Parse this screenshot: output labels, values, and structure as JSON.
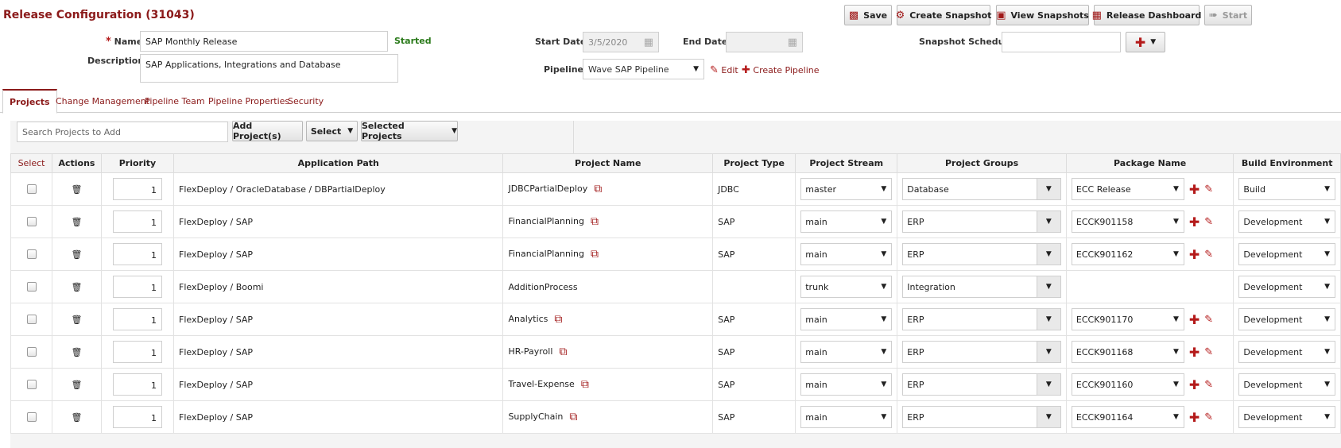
{
  "header": {
    "title": "Release Configuration (31043)",
    "buttons": {
      "save": "Save",
      "create_snapshot": "Create Snapshot",
      "view_snapshots": "View Snapshots",
      "release_dashboard": "Release Dashboard",
      "start": "Start"
    }
  },
  "form": {
    "name_label": "Name",
    "name_value": "SAP Monthly Release",
    "status": "Started",
    "description_label": "Description",
    "description_value": "SAP Applications, Integrations and Database",
    "start_date_label": "Start Date",
    "start_date_value": "3/5/2020",
    "end_date_label": "End Date",
    "end_date_value": "",
    "pipeline_label": "Pipeline",
    "pipeline_value": "Wave SAP Pipeline",
    "edit_link": "Edit",
    "create_pipeline_link": "Create Pipeline",
    "snapshot_schedule_label": "Snapshot Schedule",
    "snapshot_schedule_value": ""
  },
  "tabs": [
    {
      "label": "Projects",
      "active": true
    },
    {
      "label": "Change Management",
      "active": false
    },
    {
      "label": "Pipeline Team",
      "active": false
    },
    {
      "label": "Pipeline Properties",
      "active": false
    },
    {
      "label": "Security",
      "active": false
    }
  ],
  "toolbar": {
    "search_placeholder": "Search Projects to Add",
    "add_projects": "Add Project(s)",
    "select": "Select",
    "selected_projects": "Selected Projects"
  },
  "table": {
    "columns": [
      "Select",
      "Actions",
      "Priority",
      "Application Path",
      "Project Name",
      "Project Type",
      "Project Stream",
      "Project Groups",
      "Package Name",
      "Build Environment"
    ],
    "rows": [
      {
        "priority": "1",
        "path": "FlexDeploy / OracleDatabase / DBPartialDeploy",
        "project": "JDBCPartialDeploy",
        "type": "JDBC",
        "stream": "master",
        "group": "Database",
        "package": "ECC Release",
        "env": "Build"
      },
      {
        "priority": "1",
        "path": "FlexDeploy / SAP",
        "project": "FinancialPlanning",
        "type": "SAP",
        "stream": "main",
        "group": "ERP",
        "package": "ECCK901158",
        "env": "Development"
      },
      {
        "priority": "1",
        "path": "FlexDeploy / SAP",
        "project": "FinancialPlanning",
        "type": "SAP",
        "stream": "main",
        "group": "ERP",
        "package": "ECCK901162",
        "env": "Development"
      },
      {
        "priority": "1",
        "path": "FlexDeploy / Boomi",
        "project": "AdditionProcess",
        "type": "",
        "stream": "trunk",
        "group": "Integration",
        "package": "",
        "env": "Development"
      },
      {
        "priority": "1",
        "path": "FlexDeploy / SAP",
        "project": "Analytics",
        "type": "SAP",
        "stream": "main",
        "group": "ERP",
        "package": "ECCK901170",
        "env": "Development"
      },
      {
        "priority": "1",
        "path": "FlexDeploy / SAP",
        "project": "HR-Payroll",
        "type": "SAP",
        "stream": "main",
        "group": "ERP",
        "package": "ECCK901168",
        "env": "Development"
      },
      {
        "priority": "1",
        "path": "FlexDeploy / SAP",
        "project": "Travel-Expense",
        "type": "SAP",
        "stream": "main",
        "group": "ERP",
        "package": "ECCK901160",
        "env": "Development"
      },
      {
        "priority": "1",
        "path": "FlexDeploy / SAP",
        "project": "SupplyChain",
        "type": "SAP",
        "stream": "main",
        "group": "ERP",
        "package": "ECCK901164",
        "env": "Development"
      }
    ]
  },
  "colors": {
    "accent": "#8b1a1a",
    "status_green": "#2a7a1a"
  },
  "icons": {
    "save": "floppy-disk-icon",
    "snapshot": "gear-icon",
    "view_snapshots": "camera-icon",
    "dashboard": "grid-icon",
    "start": "running-icon",
    "delete": "trash-icon",
    "copy": "copy-link-icon",
    "add": "plus-icon",
    "edit": "pencil-icon",
    "calendar": "calendar-icon"
  }
}
